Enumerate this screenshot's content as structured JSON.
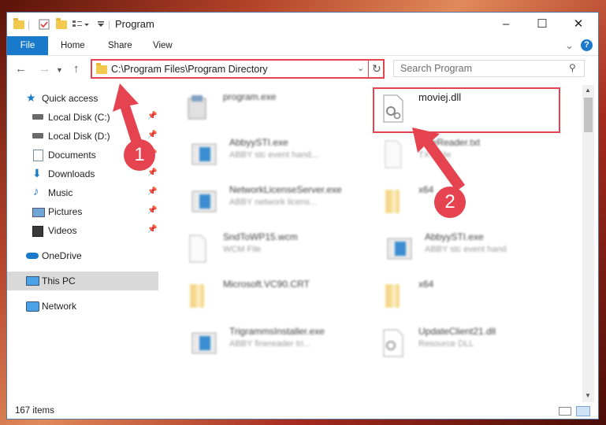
{
  "window": {
    "title": "Program"
  },
  "ribbon": {
    "tabs": [
      "File",
      "Home",
      "Share",
      "View"
    ]
  },
  "address": {
    "path": "C:\\Program Files\\Program Directory",
    "refresh_icon": "refresh-icon"
  },
  "search": {
    "placeholder": "Search Program"
  },
  "sidebar": {
    "items": [
      {
        "label": "Quick access",
        "icon": "star-icon"
      },
      {
        "label": "Local Disk (C:)",
        "icon": "drive-icon",
        "pinned": true
      },
      {
        "label": "Local Disk (D:)",
        "icon": "drive-icon",
        "pinned": true
      },
      {
        "label": "Documents",
        "icon": "document-icon",
        "pinned": true
      },
      {
        "label": "Downloads",
        "icon": "download-icon",
        "pinned": true
      },
      {
        "label": "Music",
        "icon": "music-icon",
        "pinned": true
      },
      {
        "label": "Pictures",
        "icon": "pictures-icon",
        "pinned": true
      },
      {
        "label": "Videos",
        "icon": "video-icon",
        "pinned": true
      },
      {
        "label": "OneDrive",
        "icon": "cloud-icon"
      },
      {
        "label": "This PC",
        "icon": "computer-icon",
        "selected": true
      },
      {
        "label": "Network",
        "icon": "network-icon"
      }
    ]
  },
  "files": [
    {
      "name": "program.exe",
      "type": ""
    },
    {
      "name": "moviej.dll",
      "type": ""
    },
    {
      "name": "AbbyySTI.exe",
      "type": "ABBY stc event hand..."
    },
    {
      "name": "FineReader.txt",
      "type": "TXT File"
    },
    {
      "name": "NetworkLicenseServer.exe",
      "type": "ABBY network licens..."
    },
    {
      "name": "x64",
      "type": ""
    },
    {
      "name": "SndToWP15.wcm",
      "type": "WCM File"
    },
    {
      "name": "AbbyySTI.exe",
      "type": "ABBY stc event hand"
    },
    {
      "name": "Microsoft.VC90.CRT",
      "type": ""
    },
    {
      "name": "x64",
      "type": ""
    },
    {
      "name": "TrigrammsInstaller.exe",
      "type": "ABBY finereader tri..."
    },
    {
      "name": "UpdateClient21.dll",
      "type": "Resource DLL"
    }
  ],
  "status": {
    "item_count": "167 items"
  },
  "annotations": {
    "step1": "1",
    "step2": "2",
    "color": "#e4434f"
  }
}
